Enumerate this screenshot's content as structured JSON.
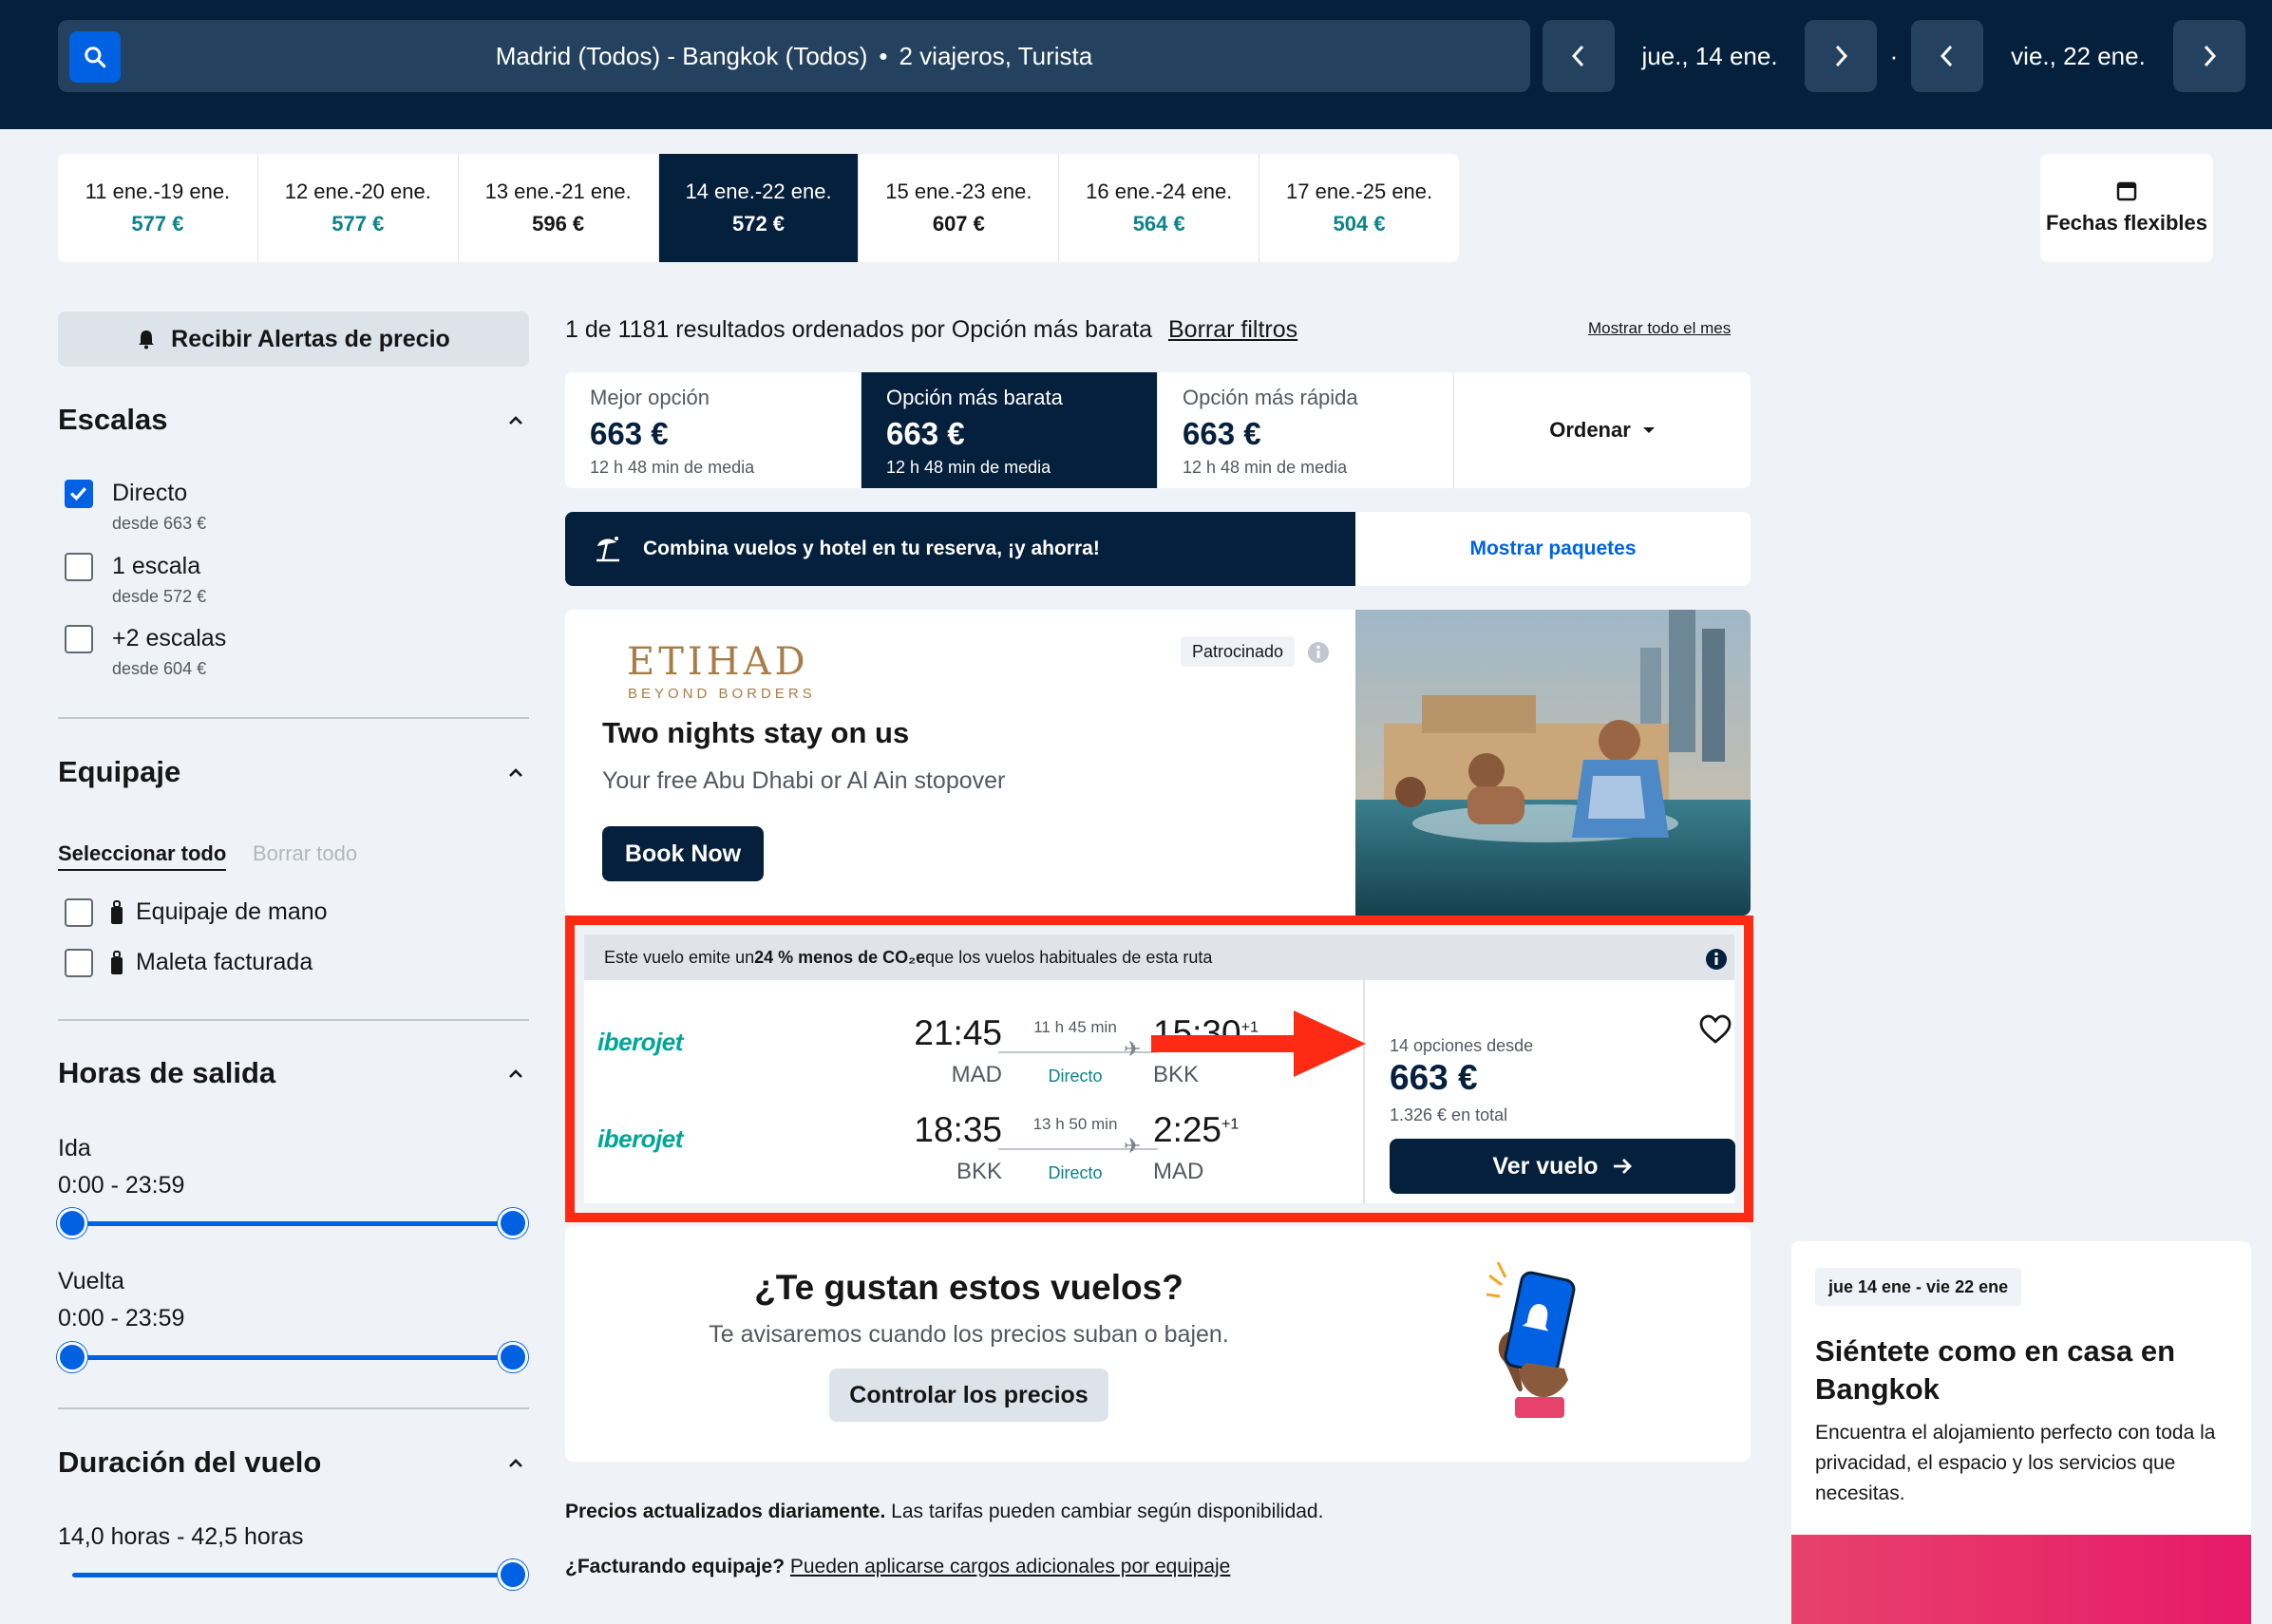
{
  "header": {
    "route": "Madrid (Todos) - Bangkok (Todos)",
    "separator": "•",
    "travellers": "2 viajeros, Turista",
    "date_out": "jue., 14 ene.",
    "date_sep": "·",
    "date_back": "vie., 22 ene."
  },
  "date_strip": [
    {
      "range": "11 ene.-19 ene.",
      "price": "577 €",
      "cheap": true
    },
    {
      "range": "12 ene.-20 ene.",
      "price": "577 €",
      "cheap": true
    },
    {
      "range": "13 ene.-21 ene.",
      "price": "596 €",
      "cheap": false
    },
    {
      "range": "14 ene.-22 ene.",
      "price": "572 €",
      "cheap": false,
      "selected": true
    },
    {
      "range": "15 ene.-23 ene.",
      "price": "607 €",
      "cheap": false
    },
    {
      "range": "16 ene.-24 ene.",
      "price": "564 €",
      "cheap": true
    },
    {
      "range": "17 ene.-25 ene.",
      "price": "504 €",
      "cheap": true
    }
  ],
  "flexible_dates": "Fechas flexibles",
  "sidebar": {
    "alert_button": "Recibir Alertas de precio",
    "stops_title": "Escalas",
    "stops": [
      {
        "label": "Directo",
        "sub": "desde 663 €",
        "checked": true
      },
      {
        "label": "1 escala",
        "sub": "desde 572 €",
        "checked": false
      },
      {
        "label": "+2 escalas",
        "sub": "desde 604 €",
        "checked": false
      }
    ],
    "bags_title": "Equipaje",
    "select_all": "Seleccionar todo",
    "clear_all": "Borrar todo",
    "bags": [
      {
        "label": "Equipaje de mano",
        "checked": false
      },
      {
        "label": "Maleta facturada",
        "checked": false
      }
    ],
    "times_title": "Horas de salida",
    "outbound_label": "Ida",
    "outbound_range": "0:00 - 23:59",
    "return_label": "Vuelta",
    "return_range": "0:00 - 23:59",
    "duration_title": "Duración del vuelo",
    "duration_range": "14,0 horas - 42,5 horas"
  },
  "results": {
    "summary": "1 de 1181 resultados ordenados por Opción más barata",
    "clear_filters": "Borrar filtros",
    "show_month": "Mostrar todo el mes",
    "sort_options": [
      {
        "label": "Mejor opción",
        "price": "663 €",
        "sub": "12 h 48 min de media",
        "selected": false
      },
      {
        "label": "Opción más barata",
        "price": "663 €",
        "sub": "12 h 48 min de media",
        "selected": true
      },
      {
        "label": "Opción más rápida",
        "price": "663 €",
        "sub": "12 h 48 min de media",
        "selected": false
      }
    ],
    "sort_button": "Ordenar",
    "combo_text": "Combina vuelos y hotel en tu reserva, ¡y ahorra!",
    "combo_link": "Mostrar paquetes"
  },
  "ad": {
    "brand": "ETIHAD",
    "brand_tag": "BEYOND BORDERS",
    "sponsored": "Patrocinado",
    "title": "Two nights stay on us",
    "subtitle": "Your free Abu Dhabi or Al Ain stopover",
    "cta": "Book Now"
  },
  "flight": {
    "co2_pre": "Este vuelo emite un ",
    "co2_bold": "24 % menos de CO₂e",
    "co2_post": " que los vuelos habituales de esta ruta",
    "legs": [
      {
        "airline": "iberojet",
        "dep_time": "21:45",
        "dep_ap": "MAD",
        "duration": "11 h 45 min",
        "stops": "Directo",
        "arr_time": "15:30",
        "arr_plus": "+1",
        "arr_ap": "BKK"
      },
      {
        "airline": "iberojet",
        "dep_time": "18:35",
        "dep_ap": "BKK",
        "duration": "13 h 50 min",
        "stops": "Directo",
        "arr_time": "2:25",
        "arr_plus": "+1",
        "arr_ap": "MAD"
      }
    ],
    "options_from": "14 opciones desde",
    "price": "663 €",
    "total": "1.326 € en total",
    "cta": "Ver vuelo"
  },
  "like": {
    "title": "¿Te gustan estos vuelos?",
    "subtitle": "Te avisaremos cuando los precios suban o bajen.",
    "button": "Controlar los precios"
  },
  "notes": {
    "n1_bold": "Precios actualizados diariamente.",
    "n1_rest": " Las tarifas pueden cambiar según disponibilidad.",
    "n2_bold": "¿Facturando equipaje?",
    "n2_link": "Pueden aplicarse cargos adicionales por equipaje"
  },
  "hotel": {
    "badge": "jue 14 ene - vie 22 ene",
    "title": "Siéntete como en casa en Bangkok",
    "text": "Encuentra el alojamiento perfecto con toda la privacidad, el espacio y los servicios que necesitas."
  },
  "colors": {
    "navy": "#05203c",
    "blue": "#0062e3",
    "teal": "#0c838a",
    "highlight": "#ff2a14"
  }
}
